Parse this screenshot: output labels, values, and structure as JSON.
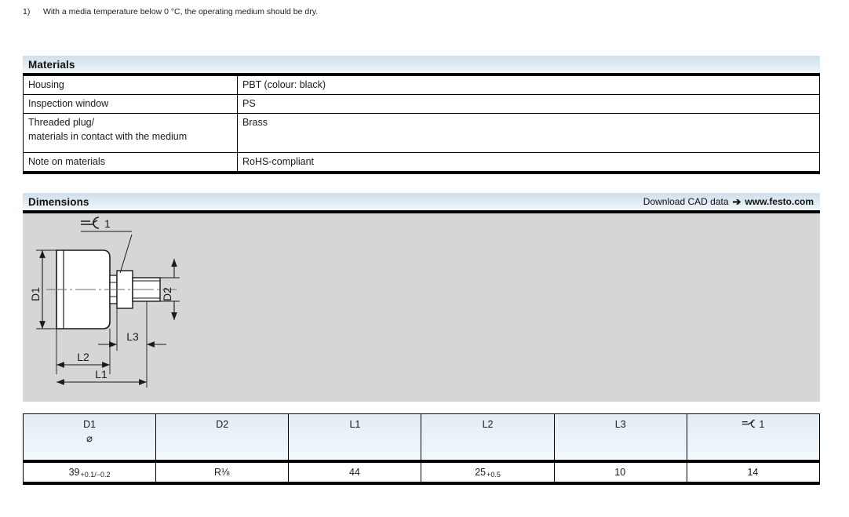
{
  "footnote": {
    "marker": "1)",
    "text": "With a media temperature below 0 °C, the operating medium should be dry."
  },
  "materials": {
    "title": "Materials",
    "rows": [
      {
        "key": "Housing",
        "value": "PBT (colour: black)"
      },
      {
        "key": "Inspection window",
        "value": "PS"
      },
      {
        "key": "Threaded plug/",
        "key2": "materials in contact with the medium",
        "value": "Brass"
      },
      {
        "key": "Note on materials",
        "value": "RoHS-compliant"
      }
    ]
  },
  "dimensions": {
    "title": "Dimensions",
    "cad_text": "Download CAD data",
    "cad_arrow": "➔",
    "cad_url": "www.festo.com",
    "drawing": {
      "labels": {
        "d1": "D1",
        "d2": "D2",
        "l1": "L1",
        "l2": "L2",
        "l3": "L3",
        "spanner": "1"
      }
    }
  },
  "dimension_table": {
    "columns": [
      {
        "header": "D1",
        "subheader": "⌀",
        "symbol": false
      },
      {
        "header": "D2",
        "subheader": "",
        "symbol": false
      },
      {
        "header": "L1",
        "subheader": "",
        "symbol": false
      },
      {
        "header": "L2",
        "subheader": "",
        "symbol": false
      },
      {
        "header": "L3",
        "subheader": "",
        "symbol": false
      },
      {
        "header": "1",
        "subheader": "",
        "symbol": true
      }
    ],
    "values": [
      {
        "main": "39",
        "tolerance": "+0.1/−0.2"
      },
      {
        "main": "R⅛",
        "tolerance": ""
      },
      {
        "main": "44",
        "tolerance": ""
      },
      {
        "main": "25",
        "tolerance": "+0.5"
      },
      {
        "main": "10",
        "tolerance": ""
      },
      {
        "main": "14",
        "tolerance": ""
      }
    ]
  },
  "colors": {
    "header_blue": "#cfe0ea",
    "drawing_bg": "#d6d6d6",
    "line": "#1a1a1a"
  }
}
